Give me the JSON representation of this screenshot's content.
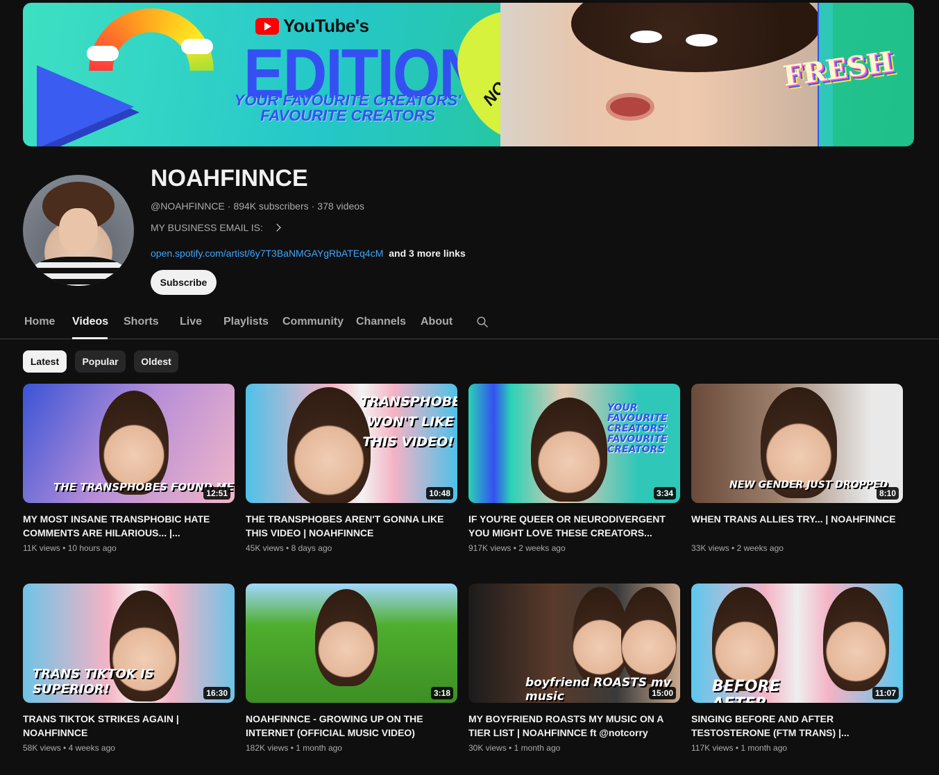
{
  "banner": {
    "yt_text": "YouTube's",
    "edition": "EDITION",
    "tagline_1": "YOUR FAVOURITE CREATORS'",
    "tagline_2": "FAVOURITE CREATORS",
    "pick_text": "NOAHFINNCE",
    "fresh": "FRESH",
    "colors": {
      "background": "#2fc7b8",
      "accent": "#3550f2",
      "pick": "#d6f23c"
    }
  },
  "channel": {
    "name": "NOAHFINNCE",
    "handle": "@NOAHFINNCE",
    "subscribers": "894K subscribers",
    "videos": "378 videos",
    "business_email_label": "MY BUSINESS EMAIL IS:",
    "link": "open.spotify.com/artist/6y7T3BaNMGAYgRbATEq4cM",
    "more_links": "and 3 more links",
    "subscribe_label": "Subscribe"
  },
  "tabs": [
    "Home",
    "Videos",
    "Shorts",
    "Live",
    "Playlists",
    "Community",
    "Channels",
    "About"
  ],
  "active_tab": "Videos",
  "filters": {
    "latest": "Latest",
    "popular": "Popular",
    "oldest": "Oldest",
    "selected": "Latest"
  },
  "videos": [
    {
      "title": "MY MOST INSANE TRANSPHOBIC HATE COMMENTS ARE HILARIOUS... |...",
      "views": "11K views",
      "age": "10 hours ago",
      "duration": "12:51",
      "thumb_text": "THE TRANSPHOBES FOUND ME"
    },
    {
      "title": "THE TRANSPHOBES AREN'T GONNA LIKE THIS VIDEO | NOAHFINNCE",
      "views": "45K views",
      "age": "8 days ago",
      "duration": "10:48",
      "thumb_text": "TRANSPHOBES WON'T LIKE THIS VIDEO!"
    },
    {
      "title": "IF YOU'RE QUEER OR NEURODIVERGENT YOU MIGHT LOVE THESE CREATORS...",
      "views": "917K views",
      "age": "2 weeks ago",
      "duration": "3:34",
      "thumb_text": "YOUR FAVOURITE CREATORS' FAVOURITE CREATORS"
    },
    {
      "title": "WHEN TRANS ALLIES TRY... | NOAHFINNCE",
      "views": "33K views",
      "age": "2 weeks ago",
      "duration": "8:10",
      "thumb_text": "NEW GENDER JUST DROPPED"
    },
    {
      "title": "TRANS TIKTOK STRIKES AGAIN | NOAHFINNCE",
      "views": "58K views",
      "age": "4 weeks ago",
      "duration": "16:30",
      "thumb_text": "TRANS TIKTOK IS SUPERIOR!"
    },
    {
      "title": "NOAHFINNCE - GROWING UP ON THE INTERNET (OFFICIAL MUSIC VIDEO)",
      "views": "182K views",
      "age": "1 month ago",
      "duration": "3:18",
      "thumb_text": ""
    },
    {
      "title": "MY BOYFRIEND ROASTS MY MUSIC ON A TIER LIST | NOAHFINNCE ft @notcorry",
      "views": "30K views",
      "age": "1 month ago",
      "duration": "15:00",
      "thumb_text": "boyfriend ROASTS my music"
    },
    {
      "title": "SINGING BEFORE AND AFTER TESTOSTERONE (FTM TRANS) |...",
      "views": "117K views",
      "age": "1 month ago",
      "duration": "11:07",
      "thumb_text": "BEFORE AFTER"
    }
  ]
}
